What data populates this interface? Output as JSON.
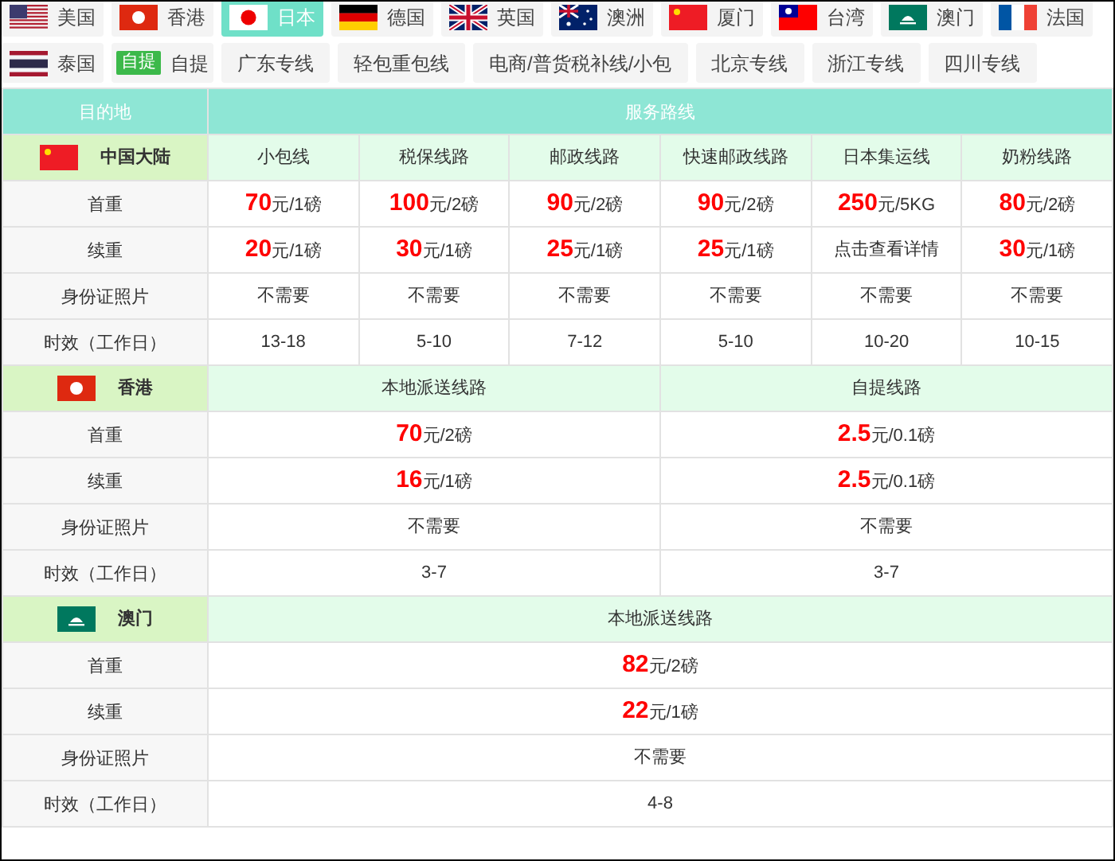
{
  "tabs": [
    [
      {
        "kind": "flag",
        "label": "美国",
        "selected": false
      },
      {
        "kind": "flag",
        "label": "香港",
        "selected": false
      },
      {
        "kind": "flag",
        "label": "日本",
        "selected": true
      },
      {
        "kind": "flag",
        "label": "德国",
        "selected": false
      },
      {
        "kind": "flag",
        "label": "英国",
        "selected": false
      },
      {
        "kind": "flag",
        "label": "澳洲",
        "selected": false
      },
      {
        "kind": "flag",
        "label": "厦门",
        "selected": false
      },
      {
        "kind": "flag",
        "label": "台湾",
        "selected": false
      },
      {
        "kind": "flag",
        "label": "澳门",
        "selected": false
      },
      {
        "kind": "flag",
        "label": "法国",
        "selected": false
      }
    ],
    [
      {
        "kind": "flag",
        "label": "泰国",
        "selected": false
      },
      {
        "kind": "badge",
        "badge": "自提",
        "label": "自提",
        "selected": false
      },
      {
        "kind": "text",
        "label": "广东专线",
        "selected": false
      },
      {
        "kind": "text",
        "label": "轻包重包线",
        "selected": false
      },
      {
        "kind": "text",
        "label": "电商/普货税补线/小包",
        "selected": false
      },
      {
        "kind": "text",
        "label": "北京专线",
        "selected": false
      },
      {
        "kind": "text",
        "label": "浙江专线",
        "selected": false
      },
      {
        "kind": "text",
        "label": "四川专线",
        "selected": false
      }
    ]
  ],
  "table": {
    "columns": [
      "目的地",
      "服务路线"
    ],
    "sections": [
      {
        "region": "中国大陆",
        "routes": [
          "小包线",
          "税保线路",
          "邮政线路",
          "快速邮政线路",
          "日本集运线",
          "奶粉线路"
        ],
        "rows": [
          {
            "label": "首重",
            "cells": [
              {
                "kind": "price",
                "amount": "70",
                "unit": "元/1磅"
              },
              {
                "kind": "price",
                "amount": "100",
                "unit": "元/2磅"
              },
              {
                "kind": "price",
                "amount": "90",
                "unit": "元/2磅"
              },
              {
                "kind": "price",
                "amount": "90",
                "unit": "元/2磅"
              },
              {
                "kind": "price",
                "amount": "250",
                "unit": "元/5KG"
              },
              {
                "kind": "price",
                "amount": "80",
                "unit": "元/2磅"
              }
            ]
          },
          {
            "label": "续重",
            "cells": [
              {
                "kind": "price",
                "amount": "20",
                "unit": "元/1磅"
              },
              {
                "kind": "price",
                "amount": "30",
                "unit": "元/1磅"
              },
              {
                "kind": "price",
                "amount": "25",
                "unit": "元/1磅"
              },
              {
                "kind": "price",
                "amount": "25",
                "unit": "元/1磅"
              },
              {
                "kind": "text",
                "text": "点击查看详情"
              },
              {
                "kind": "price",
                "amount": "30",
                "unit": "元/1磅"
              }
            ]
          },
          {
            "label": "身份证照片",
            "cells": [
              {
                "kind": "text",
                "text": "不需要"
              },
              {
                "kind": "text",
                "text": "不需要"
              },
              {
                "kind": "text",
                "text": "不需要"
              },
              {
                "kind": "text",
                "text": "不需要"
              },
              {
                "kind": "text",
                "text": "不需要"
              },
              {
                "kind": "text",
                "text": "不需要"
              }
            ]
          },
          {
            "label": "时效（工作日）",
            "cells": [
              {
                "kind": "text",
                "text": "13-18"
              },
              {
                "kind": "text",
                "text": "5-10"
              },
              {
                "kind": "text",
                "text": "7-12"
              },
              {
                "kind": "text",
                "text": "5-10"
              },
              {
                "kind": "text",
                "text": "10-20"
              },
              {
                "kind": "text",
                "text": "10-15"
              }
            ]
          }
        ]
      },
      {
        "region": "香港",
        "routes": [
          "本地派送线路",
          "自提线路"
        ],
        "rows": [
          {
            "label": "首重",
            "cells": [
              {
                "kind": "price",
                "amount": "70",
                "unit": "元/2磅"
              },
              {
                "kind": "price",
                "amount": "2.5",
                "unit": "元/0.1磅"
              }
            ]
          },
          {
            "label": "续重",
            "cells": [
              {
                "kind": "price",
                "amount": "16",
                "unit": "元/1磅"
              },
              {
                "kind": "price",
                "amount": "2.5",
                "unit": "元/0.1磅"
              }
            ]
          },
          {
            "label": "身份证照片",
            "cells": [
              {
                "kind": "text",
                "text": "不需要"
              },
              {
                "kind": "text",
                "text": "不需要"
              }
            ]
          },
          {
            "label": "时效（工作日）",
            "cells": [
              {
                "kind": "text",
                "text": "3-7"
              },
              {
                "kind": "text",
                "text": "3-7"
              }
            ]
          }
        ]
      },
      {
        "region": "澳门",
        "routes": [
          "本地派送线路"
        ],
        "rows": [
          {
            "label": "首重",
            "cells": [
              {
                "kind": "price",
                "amount": "82",
                "unit": "元/2磅"
              }
            ]
          },
          {
            "label": "续重",
            "cells": [
              {
                "kind": "price",
                "amount": "22",
                "unit": "元/1磅"
              }
            ]
          },
          {
            "label": "身份证照片",
            "cells": [
              {
                "kind": "text",
                "text": "不需要"
              }
            ]
          },
          {
            "label": "时效（工作日）",
            "cells": [
              {
                "kind": "text",
                "text": "4-8"
              }
            ]
          }
        ]
      }
    ]
  }
}
